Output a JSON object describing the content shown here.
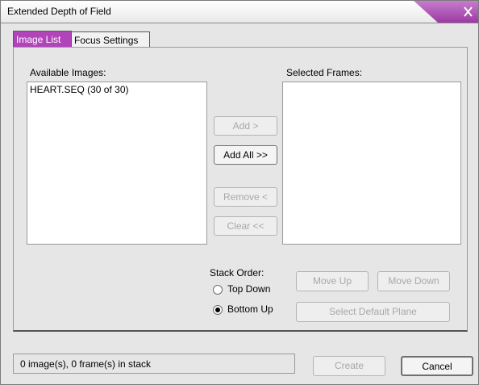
{
  "window": {
    "title": "Extended Depth of Field"
  },
  "tabs": [
    {
      "label": "Image List",
      "active": true
    },
    {
      "label": "Focus Settings",
      "active": false
    }
  ],
  "image_list": {
    "available_label": "Available Images:",
    "available_items": [
      "HEART.SEQ (30 of 30)"
    ],
    "selected_label": "Selected Frames:",
    "selected_items": []
  },
  "buttons": {
    "add": "Add >",
    "add_all": "Add All >>",
    "remove": "Remove <",
    "clear": "Clear <<",
    "move_up": "Move Up",
    "move_down": "Move Down",
    "select_default_plane": "Select Default Plane",
    "create": "Create",
    "cancel": "Cancel"
  },
  "stack_order": {
    "label": "Stack Order:",
    "options": [
      {
        "label": "Top Down",
        "checked": false
      },
      {
        "label": "Bottom Up",
        "checked": true
      }
    ]
  },
  "status": {
    "text": "0 image(s), 0 frame(s) in stack"
  },
  "colors": {
    "accent": "#b144b9",
    "dialog_bg": "#e6e6e6"
  },
  "icons": {
    "close": "close-x-icon"
  }
}
